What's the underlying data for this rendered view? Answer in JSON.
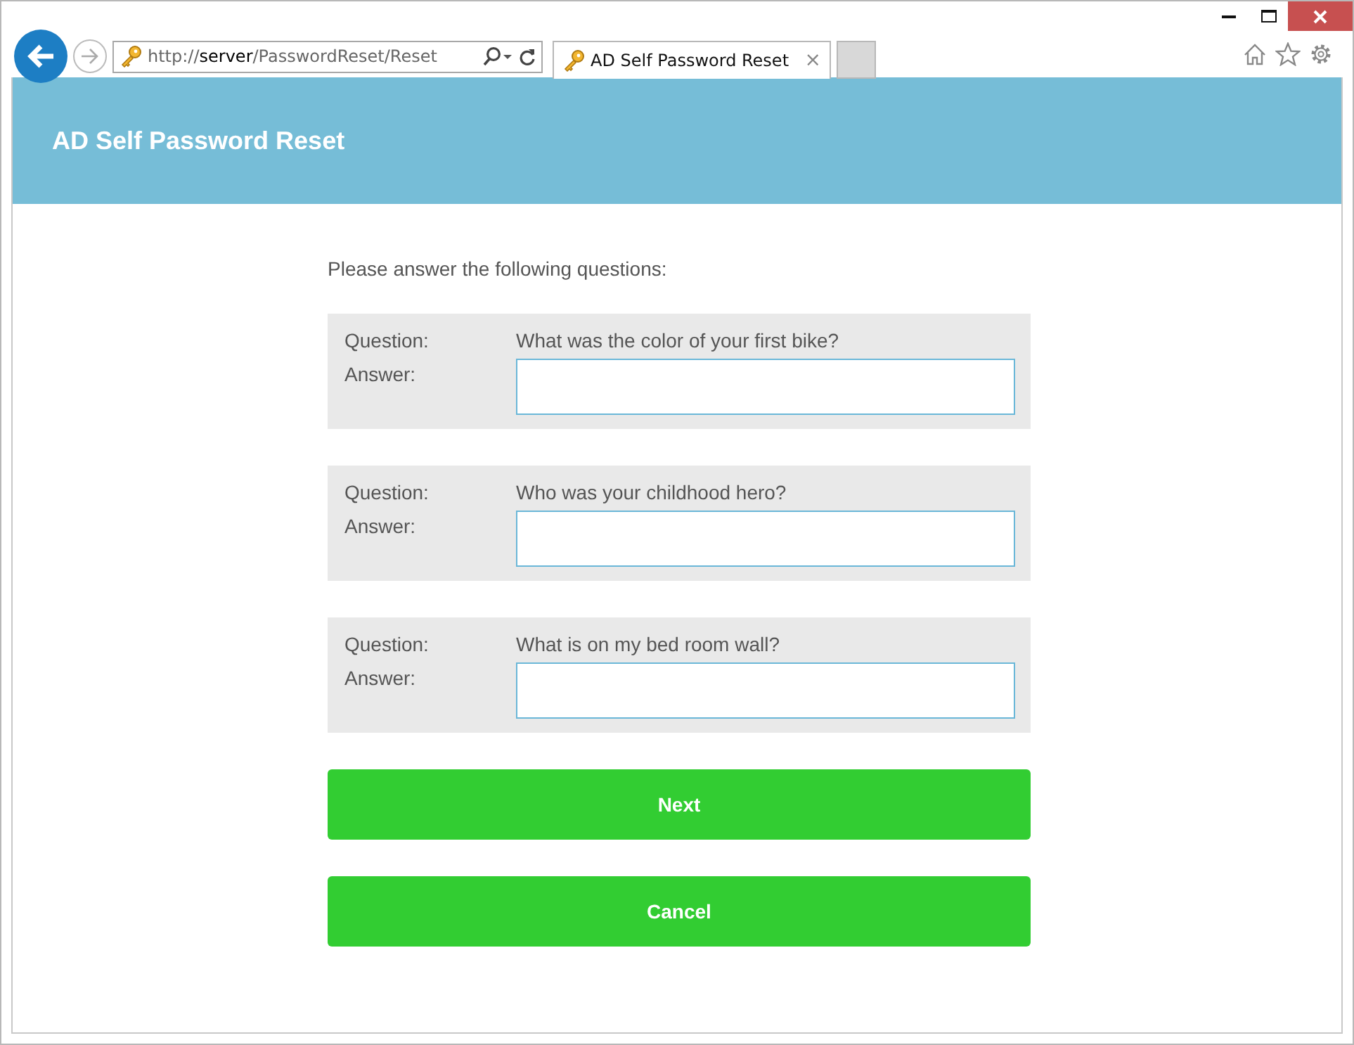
{
  "browser": {
    "address": "http://**server**/PasswordReset/Reset",
    "tabs": [
      {
        "label": "AD Self Password Reset",
        "selected": true
      }
    ],
    "tab_close": "×"
  },
  "header": {
    "title": "AD Self Password Reset"
  },
  "intro": "Please answer the following questions:",
  "questions": [
    {
      "question_label": "Question:",
      "question": "What was the color of your first bike?",
      "answer_label": "Answer:"
    },
    {
      "question_label": "Question:",
      "question": "Who was your childhood hero?",
      "answer_label": "Answer:"
    },
    {
      "question_label": "Question:",
      "question": "What is on my bed room wall?",
      "answer_label": "Answer:"
    }
  ],
  "buttons": [
    "Next",
    "Cancel"
  ]
}
